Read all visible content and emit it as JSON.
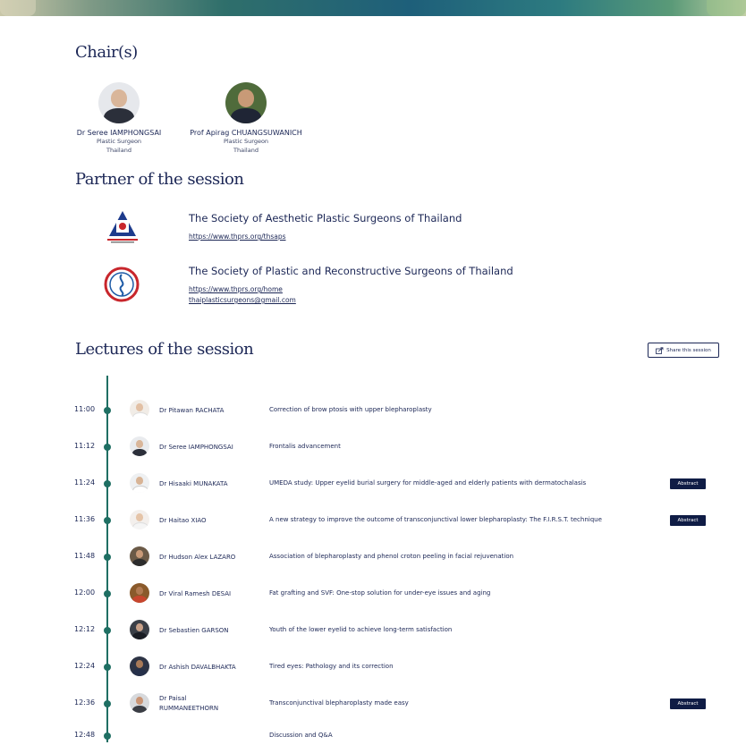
{
  "chairs": {
    "heading": "Chair(s)",
    "people": [
      {
        "name": "Dr Seree IAMPHONGSAI",
        "role": "Plastic Surgeon",
        "country": "Thailand"
      },
      {
        "name": "Prof Apirag CHUANGSUWANICH",
        "role": "Plastic Surgeon",
        "country": "Thailand"
      }
    ]
  },
  "partners": {
    "heading": "Partner of the session",
    "items": [
      {
        "title": "The Society of Aesthetic Plastic Surgeons of Thailand",
        "links": [
          "https://www.thprs.org/thsaps"
        ]
      },
      {
        "title": "The Society of Plastic and Reconstructive Surgeons of Thailand",
        "links": [
          "https://www.thprs.org/home",
          "thaiplasticsurgeons@gmail.com"
        ]
      }
    ]
  },
  "lectures": {
    "heading": "Lectures of the session",
    "share_label": "Share this session",
    "abstract_label": "Abstract",
    "items": [
      {
        "time": "11:00",
        "speaker": "Dr Pitawan RACHATA",
        "topic": "Correction of brow ptosis with upper blepharoplasty",
        "abstract": false
      },
      {
        "time": "11:12",
        "speaker": "Dr Seree IAMPHONGSAI",
        "topic": "Frontalis advancement",
        "abstract": false
      },
      {
        "time": "11:24",
        "speaker": "Dr Hisaaki MUNAKATA",
        "topic": "UMEDA study: Upper eyelid burial surgery for middle-aged and elderly patients with dermatochalasis",
        "abstract": true
      },
      {
        "time": "11:36",
        "speaker": "Dr Haitao XIAO",
        "topic": "A new strategy to improve the outcome of transconjunctival lower blepharoplasty: The F.I.R.S.T. technique",
        "abstract": true
      },
      {
        "time": "11:48",
        "speaker": "Dr Hudson Alex LAZARO",
        "topic": "Association of blepharoplasty and phenol croton peeling in facial rejuvenation",
        "abstract": false
      },
      {
        "time": "12:00",
        "speaker": "Dr Viral Ramesh DESAI",
        "topic": "Fat grafting and SVF: One-stop solution for under-eye issues and aging",
        "abstract": false
      },
      {
        "time": "12:12",
        "speaker": "Dr Sebastien GARSON",
        "topic": "Youth of the lower eyelid to achieve long-term satisfaction",
        "abstract": false
      },
      {
        "time": "12:24",
        "speaker": "Dr Ashish DAVALBHAKTA",
        "topic": "Tired eyes: Pathology and its correction",
        "abstract": false
      },
      {
        "time": "12:36",
        "speaker_line1": "Dr Paisal",
        "speaker_line2": "RUMMANEETHORN",
        "topic": "Transconjunctival blepharoplasty made easy",
        "abstract": true
      },
      {
        "time": "12:48",
        "speaker": "",
        "topic": "Discussion and Q&A",
        "abstract": false
      }
    ]
  },
  "colors": {
    "navy": "#1c2756",
    "timeline": "#1f6f63",
    "abstract_bg": "#0f1c45"
  }
}
